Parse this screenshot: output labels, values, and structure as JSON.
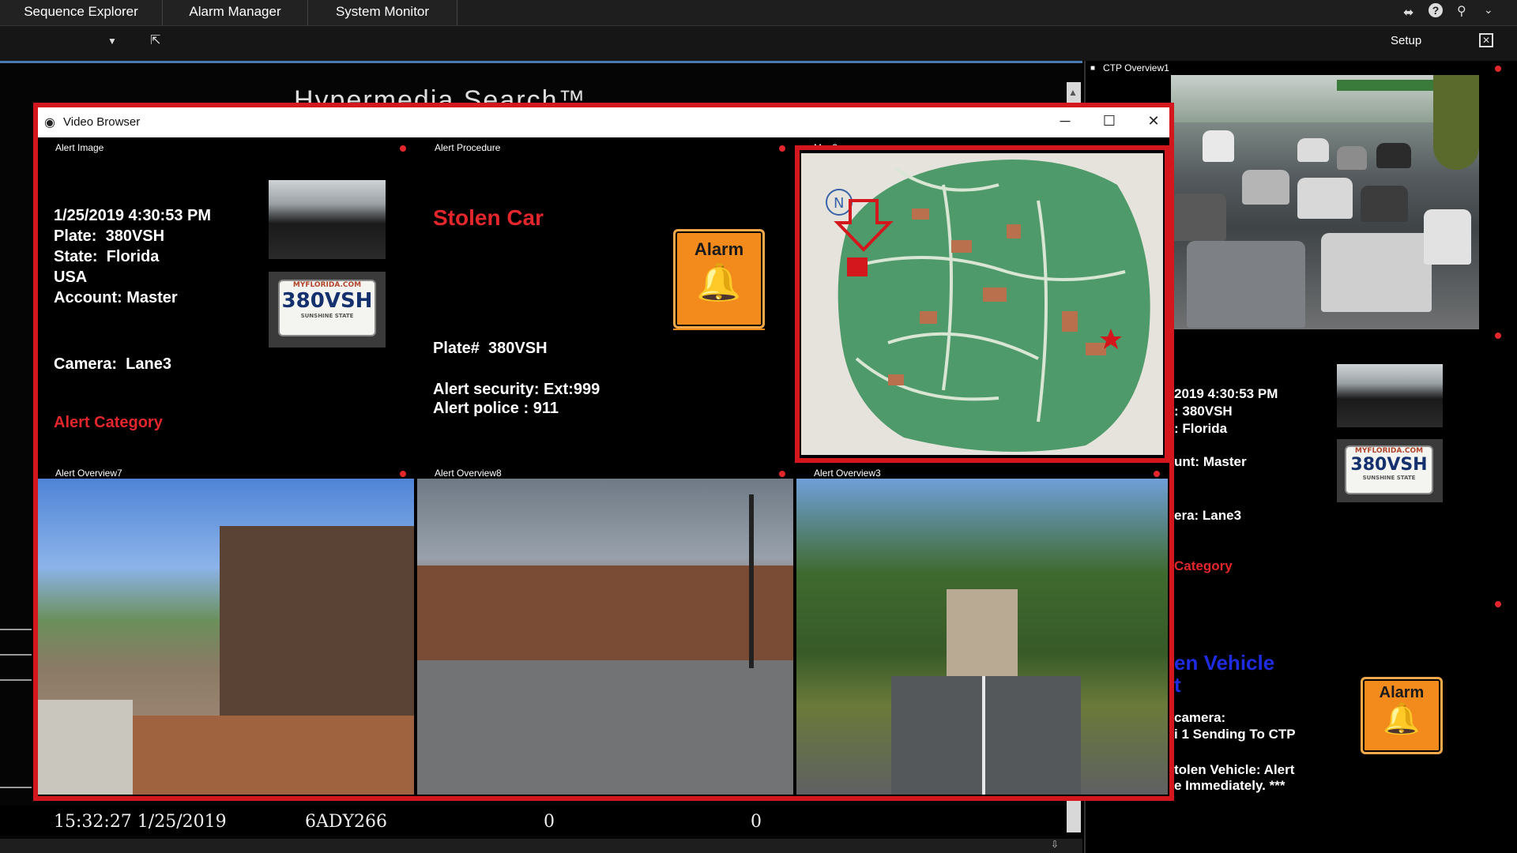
{
  "menu": {
    "tabs": [
      {
        "label": "Sequence Explorer"
      },
      {
        "label": "Alarm Manager"
      },
      {
        "label": "System Monitor"
      }
    ]
  },
  "toolbar": {
    "setup_label": "Setup",
    "dropdown_icon": "chevron-down-icon",
    "action_icon": "cursor-move-icon"
  },
  "background": {
    "title": "Hypermedia Search™",
    "footer": {
      "timestamp": "15:32:27 1/25/2019",
      "plate": "6ADY266",
      "count1": "0",
      "count2": "0"
    }
  },
  "ctp": {
    "title": "CTP Overview1",
    "info_lines": [
      "2019 4:30:53 PM",
      ": 380VSH",
      ": Florida",
      "unt: Master",
      "era: Lane3"
    ],
    "category": "Category",
    "procedure_lines": [
      "en Vehicle",
      "t"
    ],
    "detail_lines": [
      "camera:",
      "i 1 Sending To CTP",
      "tolen Vehicle: Alert",
      "e Immediately. ***"
    ],
    "alarm_label": "Alarm"
  },
  "video_browser": {
    "title": "Video Browser",
    "window_controls": {
      "minimize": "─",
      "maximize": "☐",
      "close": "✕"
    },
    "alert_image": {
      "title": "Alert Image",
      "lines": [
        "1/25/2019 4:30:53 PM",
        "Plate:  380VSH",
        "State:  Florida",
        "USA",
        "Account: Master"
      ],
      "camera": "Camera:  Lane3",
      "category": "Alert Category",
      "plate_top": "MYFLORIDA.COM",
      "plate_num": "380VSH",
      "plate_bottom": "SUNSHINE STATE"
    },
    "alert_procedure": {
      "title": "Alert Procedure",
      "heading": "Stolen Car",
      "alarm_label": "Alarm",
      "plate": "Plate#  380VSH",
      "security": "Alert security: Ext:999",
      "police": "Alert police : 911"
    },
    "map": {
      "title": "Map3"
    },
    "overviews": [
      {
        "title": "Alert Overview7"
      },
      {
        "title": "Alert Overview8"
      },
      {
        "title": "Alert Overview3"
      }
    ]
  },
  "colors": {
    "alert_red": "#e3262b",
    "frame_red": "#d4161d",
    "alarm_orange": "#f28a1c",
    "link_blue": "#1f2be0",
    "map_green": "#4f9a6a"
  }
}
